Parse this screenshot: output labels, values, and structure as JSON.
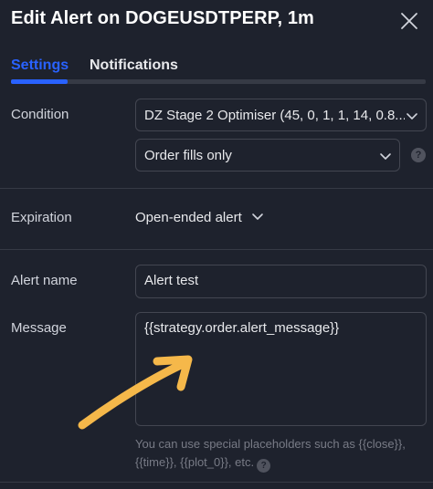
{
  "dialog": {
    "title": "Edit Alert on DOGEUSDTPERP, 1m"
  },
  "tabs": [
    {
      "label": "Settings",
      "active": true
    },
    {
      "label": "Notifications",
      "active": false
    }
  ],
  "condition": {
    "label": "Condition",
    "strategy_value": "DZ Stage 2 Optimiser (45, 0, 1, 1, 14, 0.8...",
    "trigger_value": "Order fills only",
    "help": "?"
  },
  "expiration": {
    "label": "Expiration",
    "value": "Open-ended alert"
  },
  "alert_name": {
    "label": "Alert name",
    "value": "Alert test"
  },
  "message": {
    "label": "Message",
    "value": "{{strategy.order.alert_message}}",
    "hint": "You can use special placeholders such as {{close}}, {{time}}, {{plot_0}}, etc.",
    "help": "?"
  },
  "colors": {
    "background": "#1e222d",
    "accent": "#2962ff",
    "border": "#434651",
    "annotation_arrow": "#f5b84a"
  },
  "icons": {
    "close": "close-icon",
    "chevron": "chevron-down-icon",
    "help": "question-circle-icon",
    "annotation": "hand-drawn-arrow"
  }
}
